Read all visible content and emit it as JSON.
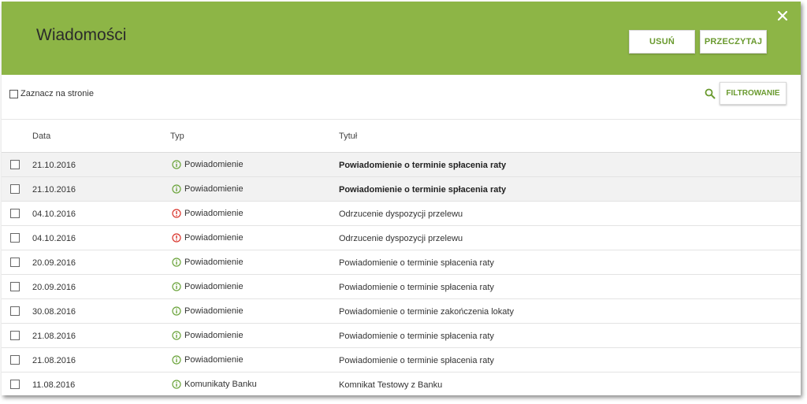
{
  "header": {
    "title": "Wiadomości",
    "delete_label": "USUŃ",
    "read_label": "PRZECZYTAJ",
    "close_icon": "close-icon"
  },
  "toolbar": {
    "select_all_label": "Zaznacz na stronie",
    "filter_label": "FILTROWANIE",
    "search_icon": "search-icon"
  },
  "columns": {
    "date": "Data",
    "type": "Typ",
    "title": "Tytuł"
  },
  "colors": {
    "header_bg": "#8db546",
    "accent": "#6a9a2f",
    "info_icon": "#6aa33a",
    "warning_icon": "#d9342b"
  },
  "rows": [
    {
      "date": "21.10.2016",
      "type": "Powiadomienie",
      "icon": "info-icon",
      "title": "Powiadomienie o terminie spłacenia raty",
      "unread": true
    },
    {
      "date": "21.10.2016",
      "type": "Powiadomienie",
      "icon": "info-icon",
      "title": "Powiadomienie o terminie spłacenia raty",
      "unread": true
    },
    {
      "date": "04.10.2016",
      "type": "Powiadomienie",
      "icon": "warning-icon",
      "title": "Odrzucenie dyspozycji przelewu",
      "unread": false
    },
    {
      "date": "04.10.2016",
      "type": "Powiadomienie",
      "icon": "warning-icon",
      "title": "Odrzucenie dyspozycji przelewu",
      "unread": false
    },
    {
      "date": "20.09.2016",
      "type": "Powiadomienie",
      "icon": "info-icon",
      "title": "Powiadomienie o terminie spłacenia raty",
      "unread": false
    },
    {
      "date": "20.09.2016",
      "type": "Powiadomienie",
      "icon": "info-icon",
      "title": "Powiadomienie o terminie spłacenia raty",
      "unread": false
    },
    {
      "date": "30.08.2016",
      "type": "Powiadomienie",
      "icon": "info-icon",
      "title": "Powiadomienie o terminie zakończenia lokaty",
      "unread": false
    },
    {
      "date": "21.08.2016",
      "type": "Powiadomienie",
      "icon": "info-icon",
      "title": "Powiadomienie o terminie spłacenia raty",
      "unread": false
    },
    {
      "date": "21.08.2016",
      "type": "Powiadomienie",
      "icon": "info-icon",
      "title": "Powiadomienie o terminie spłacenia raty",
      "unread": false
    },
    {
      "date": "11.08.2016",
      "type": "Komunikaty Banku",
      "icon": "info-icon",
      "title": "Komnikat Testowy z Banku",
      "unread": false
    }
  ]
}
